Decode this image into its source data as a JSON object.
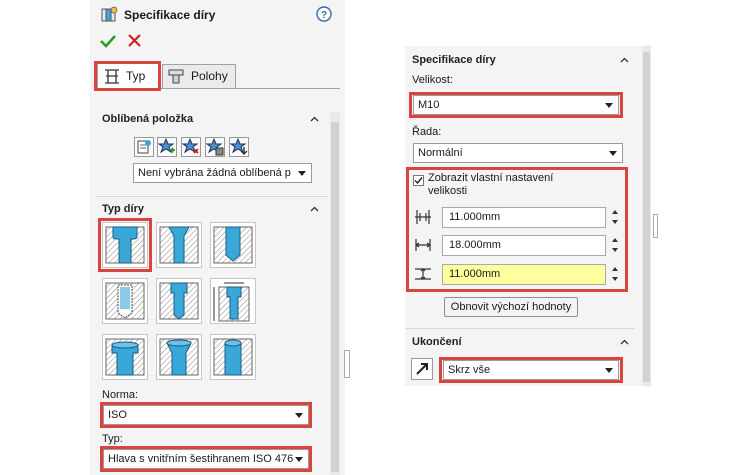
{
  "left": {
    "title": "Specifikace díry",
    "help_icon": "help-icon",
    "ok_icon": "check-icon",
    "cancel_icon": "x-icon",
    "tabs": [
      {
        "label": "Typ",
        "icon": "hole-type-icon"
      },
      {
        "label": "Polohy",
        "icon": "positions-icon"
      }
    ],
    "favorites": {
      "header": "Oblíbená položka",
      "buttons": [
        "apply-defaults-icon",
        "add-favorite-icon",
        "delete-favorite-icon",
        "save-favorite-icon",
        "load-favorite-icon"
      ],
      "select_value": "Není vybrána žádná oblíbená p"
    },
    "hole_type": {
      "header": "Typ díry",
      "tiles": [
        "counterbore-icon",
        "countersink-icon",
        "simple-hole-icon",
        "straight-tap-icon",
        "tapered-tap-icon",
        "legacy-hole-icon",
        "counterbore-slot-icon",
        "countersink-slot-icon",
        "slot-icon"
      ]
    },
    "standard": {
      "label": "Norma:",
      "value": "ISO"
    },
    "type": {
      "label": "Typ:",
      "value": "Hlava s vnitřním šestihranem ISO 476"
    }
  },
  "right": {
    "spec_header": "Specifikace díry",
    "size": {
      "label": "Velikost:",
      "value": "M10"
    },
    "fit": {
      "label": "Řada:",
      "value": "Normální"
    },
    "custom": {
      "checkbox_label_1": "Zobrazit vlastní nastavení",
      "checkbox_label_2": "velikosti",
      "checked": true,
      "fields": [
        {
          "icon": "diameter-icon",
          "value": "11.000mm"
        },
        {
          "icon": "cbore-diameter-icon",
          "value": "18.000mm"
        },
        {
          "icon": "cbore-depth-icon",
          "value": "11.000mm"
        }
      ],
      "restore_button": "Obnovit výchozí hodnoty"
    },
    "end_condition": {
      "header": "Ukončení",
      "icon": "reverse-direction-icon",
      "value": "Skrz vše"
    }
  },
  "colors": {
    "highlight_red": "#d9443f",
    "hole_blue": "#3aa7d9",
    "yellow_field": "#ffff9e"
  }
}
